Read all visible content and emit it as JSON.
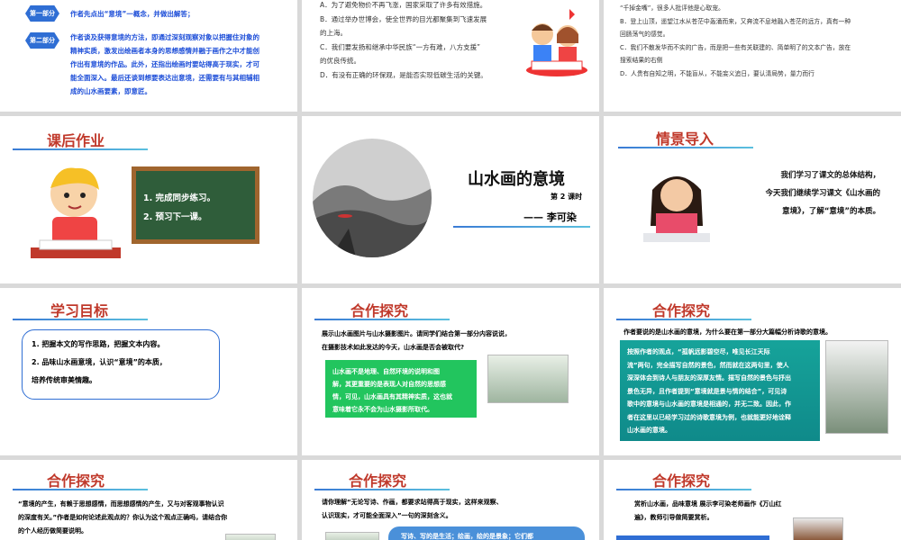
{
  "slides": {
    "s1": {
      "part1_badge": "第一部分",
      "part1_text": "作者先点出“意境”一概念，并做出解答；",
      "part2_badge": "第二部分",
      "part2_lines": [
        "作者谈及获得意境的方法，即通过深刻观察对象以把握住对象的",
        "精神实质，激发出绘画者本身的思想感情并融于画作之中才能创",
        "作出有意境的作品。此外，还指出绘画时要站得高于现实，才可",
        "能全面深入。最后还谈到想要表达出意境，还需要有与其相辅相",
        "成的山水画要素，即意匠。"
      ]
    },
    "s2": {
      "options": [
        "A．为了避免物价不再飞涨，国家采取了许多有效措施。",
        "B．通过举办世博会，使全世界的目光都聚集到飞速发展",
        "的上海。",
        "C．我们要发扬和继承中华民族“一方有难，八方支援”",
        "的优良传统。",
        "D．有没有正确的环保观，是能否实现低碳生活的关键。"
      ]
    },
    "s3": {
      "lines": [
        "“千掉金嘴”，很多人批评他是心取宠。",
        "B．登上山顶，遥望江水从苍茫中轰涌而来，又奔流不息地融入苍茫的远方，真有一种",
        "回肠荡气的感觉。",
        "C．我们不散发华而不实的广告，而是把一些有关联建的、简单明了的文本广告，放在",
        "搜索结果的右侧",
        "D．人贵有自知之明，不能盲从，不能妄义追日，要认清局势，量力而行"
      ]
    },
    "s4": {
      "title": "课后作业",
      "tasks": [
        "1. 完成同步练习。",
        "2. 预习下一课。"
      ]
    },
    "s5": {
      "title": "山水画的意境",
      "lesson": "第 2 课时",
      "author": "—— 李可染"
    },
    "s6": {
      "title": "情景导入",
      "text_lines": [
        "我们学习了课文的总体结构，",
        "今天我们继续学习课文《山水画的",
        "意境》，了解“意境”的本质。"
      ]
    },
    "s7": {
      "title": "学习目标",
      "goals": [
        "1. 把握本文的写作思路，把握文本内容。",
        "2. 品味山水画意境，认识“意境”的本质，",
        "培养传统审美情趣。"
      ]
    },
    "s8": {
      "title": "合作探究",
      "intro_lines": [
        "展示山水画图片与山水摄影图片。请同学们结合第一部分内容说说，",
        "在摄影技术如此发达的今天，山水画是否会被取代?"
      ],
      "answer_lines": [
        "山水画不是地理、自然环境的说明和图",
        "解，其更重要的是表现人对自然的思想感",
        "情，可见，山水画具有其精神实质，这也就",
        "意味着它永不会为山水摄影所取代。"
      ]
    },
    "s9": {
      "title": "合作探究",
      "question": "作者要说的是山水画的意境，为什么要在第一部分大篇幅分析诗歌的意境。",
      "answer_lines": [
        "按照作者的观点，“孤帆远影碧空尽，唯见长江天际",
        "流”两句，完全描写自然的景色，然而就在这两句里，使人",
        "深深体会到诗人与朋友的深厚友情。描写自然的景色与抒出",
        "景色无异，且作者提到“意境就是景与情的结合”，可见诗",
        "歌中的意境与山水画的意境是相通的，并无二致。因此，作",
        "者在这里以已经学习过的诗歌意境为例，也就能更好地诠释",
        "山水画的意境。"
      ]
    },
    "s10": {
      "title": "合作探究",
      "lines": [
        "“意境的产生，有赖于思想感情，而思想感情的产生，又与对客观事物认识",
        "的深度有关。”作者是如何论述此观点的？你认为这个观点正确吗，请结合你",
        "的个人经历做简要说明。"
      ]
    },
    "s11": {
      "title": "合作探究",
      "lines": [
        "请你理解“无论写诗、作画，都要求站得高于现实，这样来观察、",
        "认识现实，才可能全面深入”一句的深刻含义。"
      ],
      "pill_text": "写诗、写的是生活；绘画，绘的是景象；它们都"
    },
    "s12": {
      "title": "合作探究",
      "lines": [
        "赏析山水画，品味意境  展示李可染老师画作《万山红",
        "遍》，教师引导做简要赏析。"
      ]
    }
  }
}
